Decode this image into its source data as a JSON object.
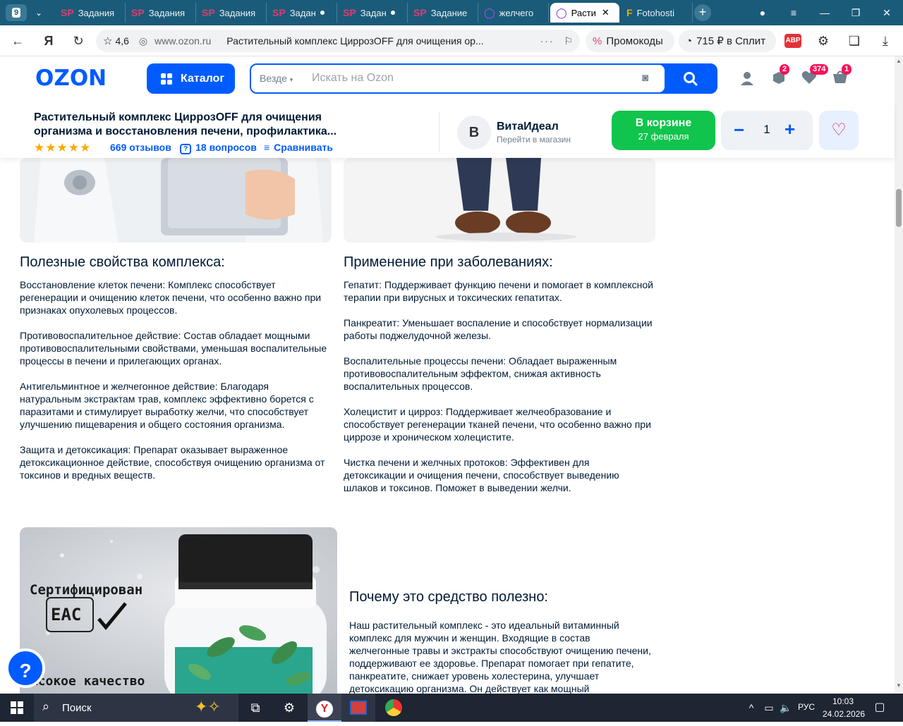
{
  "browser": {
    "tab_count": "9",
    "tabs": [
      {
        "icon": "SP",
        "label": "Задания"
      },
      {
        "icon": "SP",
        "label": "Задания"
      },
      {
        "icon": "SP",
        "label": "Задания"
      },
      {
        "icon": "SP",
        "label": "Задан"
      },
      {
        "icon": "SP",
        "label": "Задан"
      },
      {
        "icon": "SP",
        "label": "Задание"
      },
      {
        "icon": "◯",
        "label": "желчего"
      },
      {
        "icon": "◯",
        "label": "Расти"
      },
      {
        "icon": "F",
        "label": "Fotohosti"
      }
    ],
    "rating": "4,6",
    "url": "www.ozon.ru",
    "page_title": "Растительный комплекс ЦиррозOFF для очищения ор...",
    "promo_label": "Промокоды",
    "split_label": "715 ₽ в Сплит",
    "abp": "ABP"
  },
  "header": {
    "logo": "OZON",
    "catalog_label": "Каталог",
    "search_scope": "Везде",
    "search_placeholder": "Искать на Ozon",
    "badge_orders": "2",
    "badge_favorites": "374",
    "badge_cart": "1"
  },
  "product_bar": {
    "title": "Растительный комплекс ЦиррозOFF для очищения организма и восстановления печени, профилактика...",
    "stars": "★★★★★",
    "reviews": "669 отзывов",
    "questions": "18 вопросов",
    "compare": "Сравнивать",
    "seller_initial": "В",
    "seller_name": "ВитаИдеал",
    "seller_link": "Перейти в магазин",
    "cart_label": "В корзине",
    "cart_date": "27 февраля",
    "quantity": "1"
  },
  "section1": {
    "heading": "Полезные свойства комплекса:",
    "paragraphs": [
      "Восстановление клеток печени: Комплекс способствует регенерации и очищению клеток печени, что особенно важно при признаках опухолевых процессов.",
      "Противовоспалительное действие: Состав обладает мощными противовоспалительными свойствами, уменьшая воспалительные процессы в печени и прилегающих органах.",
      "Антигельминтное и желчегонное действие: Благодаря натуральным экстрактам трав, комплекс эффективно борется с паразитами и стимулирует выработку желчи, что способствует улучшению пищеварения и общего состояния организма.",
      "Защита и детоксикация: Препарат оказывает выраженное детоксикационное действие, способствуя очищению организма от токсинов и вредных веществ."
    ]
  },
  "section2": {
    "heading": "Применение при заболеваниях:",
    "paragraphs": [
      "Гепатит: Поддерживает функцию печени и помогает в комплексной терапии при вирусных и токсических гепатитах.",
      "Панкреатит: Уменьшает воспаление и способствует нормализации работы поджелудочной железы.",
      "Воспалительные процессы печени: Обладает выраженным противовоспалительным эффектом, снижая активность воспалительных процессов.",
      "Холецистит и цирроз: Поддерживает желчеобразование и способствует регенерации тканей печени, что особенно важно при циррозе и хроническом холецистите.",
      "Чистка печени и желчных протоков: Эффективен для детоксикации и очищения печени, способствует выведению шлаков и токсинов. Поможет в выведении желчи."
    ]
  },
  "section3": {
    "heading": "Почему это средство полезно:",
    "paragraph": "Наш растительный комплекс - это идеальный витаминный комплекс для мужчин и женщин. Входящие в состав желчегонные травы и экстракты способствуют очищению печени, поддерживают ее здоровье. Препарат помогает при гепатите, панкреатите, снижает уровень холестерина, улучшает детоксикацию организма. Он действует как мощный"
  },
  "product_image": {
    "cert_title": "Сертифицирован",
    "cert_mark": "EAC",
    "quality": "высокое качество"
  },
  "taskbar": {
    "search_label": "Поиск",
    "lang": "РУС",
    "time": "10:03",
    "date": "24.02.2026"
  },
  "colors": {
    "ozon_blue": "#005bff",
    "cart_green": "#10c44c",
    "badge_pink": "#f91155",
    "browser_bar": "#1b5b7a"
  }
}
